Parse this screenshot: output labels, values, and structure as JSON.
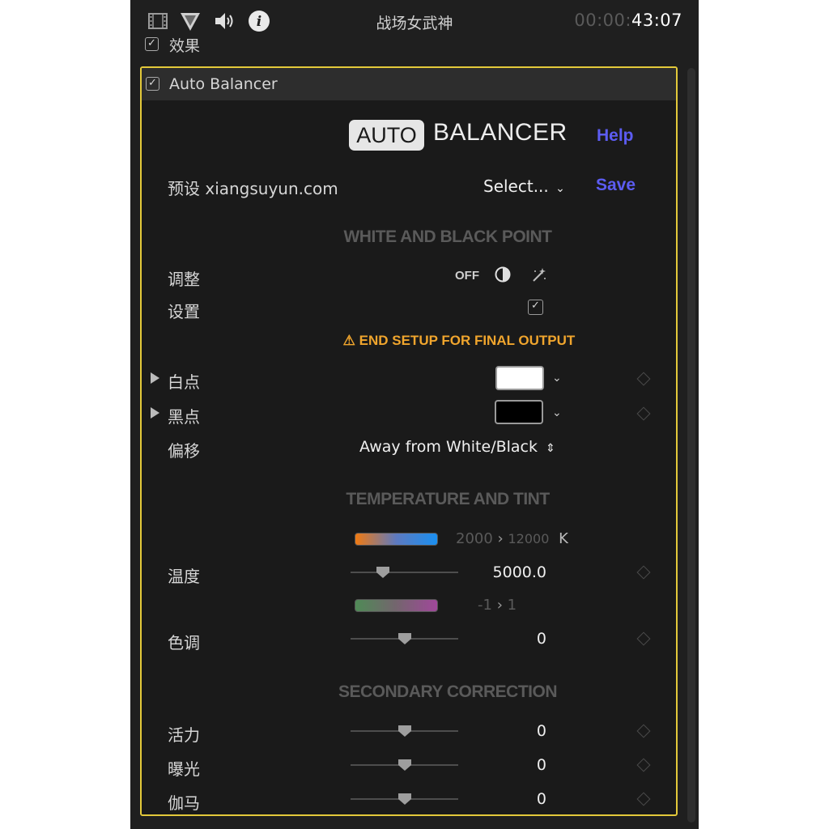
{
  "topbar": {
    "title": "战场女武神",
    "time_dim": "00:00:",
    "time_main": "43:07",
    "icons": [
      "film-icon",
      "filter-triangle-icon",
      "speaker-icon",
      "info-icon"
    ]
  },
  "effects": {
    "label": "效果",
    "checked": true
  },
  "effect": {
    "name": "Auto Balancer",
    "checked": true,
    "logo_badge": "AUTO",
    "logo_text": "BALANCER",
    "help": "Help",
    "preset_label": "预设 xiangsuyun.com",
    "preset_select": "Select...",
    "save": "Save",
    "sections": {
      "white_black": "WHITE AND BLACK POINT",
      "temp_tint": "TEMPERATURE AND TINT",
      "secondary": "SECONDARY CORRECTION"
    },
    "adjust": {
      "label": "调整",
      "off": "OFF"
    },
    "setup": {
      "label": "设置",
      "checked": true
    },
    "warning": "⚠ END SETUP FOR FINAL OUTPUT",
    "white_point": {
      "label": "白点",
      "color": "#ffffff"
    },
    "black_point": {
      "label": "黑点",
      "color": "#000000"
    },
    "offset": {
      "label": "偏移",
      "value": "Away from White/Black"
    },
    "temperature": {
      "label": "温度",
      "range_low": "2000",
      "range_high": "12000",
      "unit": "K",
      "value": "5000.0",
      "position": 0.3
    },
    "tint": {
      "label": "色调",
      "range_low": "-1",
      "range_high": "1",
      "value": "0",
      "position": 0.5
    },
    "vibrance": {
      "label": "活力",
      "value": "0",
      "position": 0.5
    },
    "exposure": {
      "label": "曝光",
      "value": "0",
      "position": 0.5
    },
    "gamma": {
      "label": "伽马",
      "value": "0",
      "position": 0.5
    },
    "colors": {
      "frame_border": "#e3c93a",
      "link": "#5c5cf2",
      "warning": "#f0a52d"
    }
  }
}
